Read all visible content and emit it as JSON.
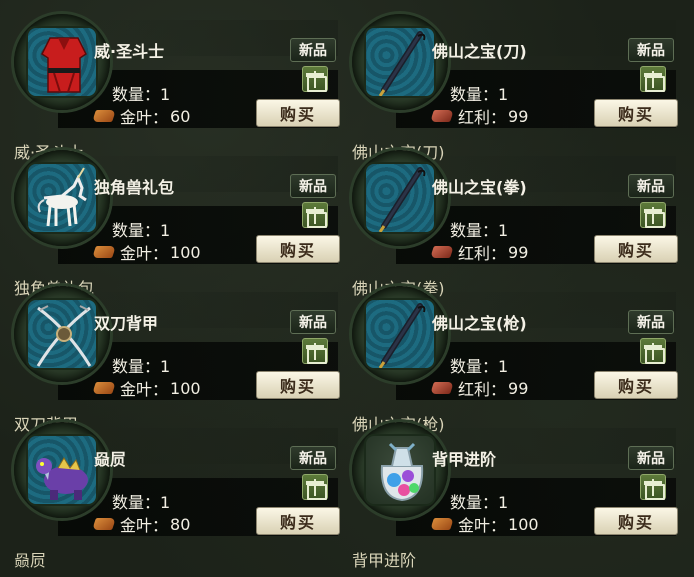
{
  "header": {
    "faded_title": ""
  },
  "labels": {
    "new": "新品",
    "buy": "购买",
    "qty_prefix": "数量：",
    "gold_leaf": "金叶：",
    "dividend": "红利："
  },
  "items": [
    {
      "name": "威·圣斗士",
      "qty": "1",
      "currency": "金叶：",
      "price": "60",
      "caption": "威·圣斗士",
      "icon": "red-robe-icon"
    },
    {
      "name": "佛山之宝(刀)",
      "qty": "1",
      "currency": "红利：",
      "price": "99",
      "caption": "佛山之宝(刀)",
      "icon": "umbrella-icon"
    },
    {
      "name": "独角兽礼包",
      "qty": "1",
      "currency": "金叶：",
      "price": "100",
      "caption": "独角兽礼包",
      "icon": "unicorn-icon"
    },
    {
      "name": "佛山之宝(拳)",
      "qty": "1",
      "currency": "红利：",
      "price": "99",
      "caption": "佛山之宝(拳)",
      "icon": "umbrella-icon"
    },
    {
      "name": "双刀背甲",
      "qty": "1",
      "currency": "金叶：",
      "price": "100",
      "caption": "双刀背甲",
      "icon": "twin-swords-icon"
    },
    {
      "name": "佛山之宝(枪)",
      "qty": "1",
      "currency": "红利：",
      "price": "99",
      "caption": "佛山之宝(枪)",
      "icon": "umbrella-icon"
    },
    {
      "name": "赑屃",
      "qty": "1",
      "currency": "金叶：",
      "price": "80",
      "caption": "赑屃",
      "icon": "dragon-turtle-icon"
    },
    {
      "name": "背甲进阶",
      "qty": "1",
      "currency": "金叶：",
      "price": "100",
      "caption": "背甲进阶",
      "icon": "gem-bag-icon"
    }
  ]
}
